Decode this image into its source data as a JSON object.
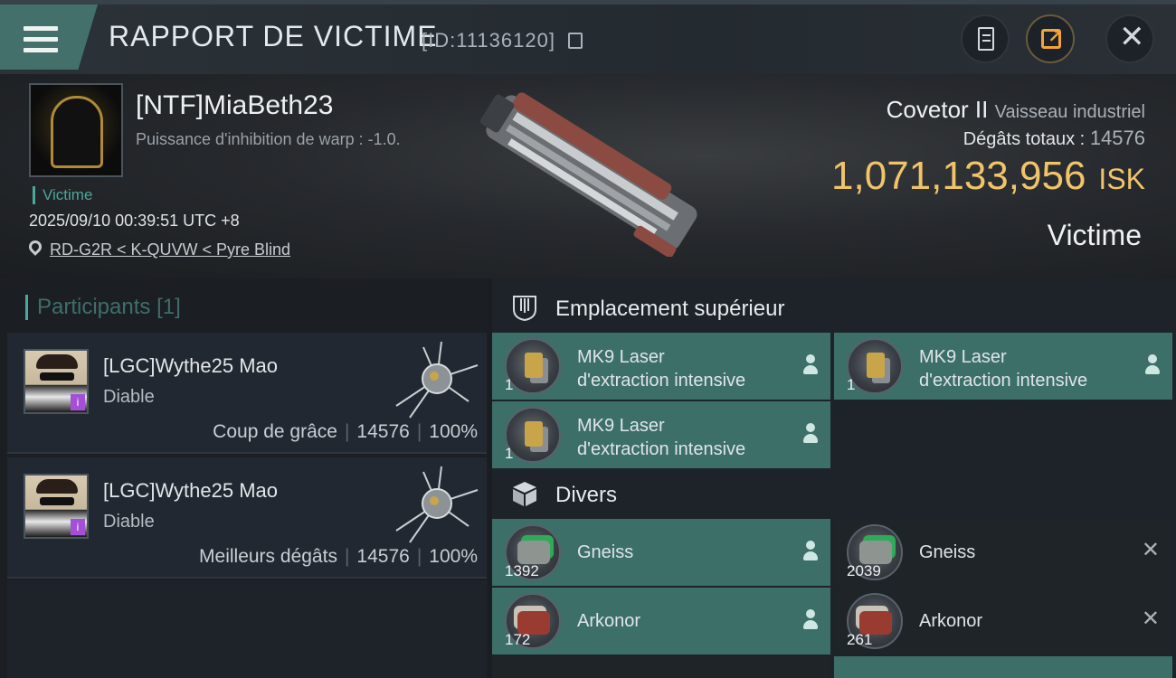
{
  "header": {
    "title": "RAPPORT DE VICTIME",
    "report_id": "[ID:11136120]"
  },
  "victim": {
    "name": "[NTF]MiaBeth23",
    "warp_strength": "Puissance d'inhibition de warp : -1.0.",
    "tag": "Victime",
    "datetime": "2025/09/10 00:39:51 UTC +8",
    "location": "RD-G2R < K-QUVW < Pyre Blind",
    "ship_name": "Covetor II",
    "ship_class": "Vaisseau industriel",
    "total_damage_label": "Dégâts totaux :",
    "total_damage": "14576",
    "isk_amount": "1,071,133,956",
    "isk_unit": "ISK",
    "role_label": "Victime"
  },
  "participants": {
    "label": "Participants",
    "count": "[1]",
    "cards": [
      {
        "name": "[LGC]Wythe25 Mao",
        "ship": "Diable",
        "role": "Coup de grâce",
        "damage": "14576",
        "percent": "100%"
      },
      {
        "name": "[LGC]Wythe25 Mao",
        "ship": "Diable",
        "role": "Meilleurs dégâts",
        "damage": "14576",
        "percent": "100%"
      }
    ]
  },
  "fitting": {
    "high_slot_title": "Emplacement supérieur",
    "misc_title": "Divers",
    "high_slots": [
      {
        "name_line1": "MK9 Laser",
        "name_line2": "d'extraction intensive",
        "qty": "1",
        "status": "dropped"
      },
      {
        "name_line1": "MK9 Laser",
        "name_line2": "d'extraction intensive",
        "qty": "1",
        "status": "dropped"
      },
      {
        "name_line1": "MK9 Laser",
        "name_line2": "d'extraction intensive",
        "qty": "1",
        "status": "dropped"
      }
    ],
    "misc": [
      {
        "name": "Gneiss",
        "qty": "1392",
        "status": "dropped"
      },
      {
        "name": "Gneiss",
        "qty": "2039",
        "status": "destroyed"
      },
      {
        "name": "Arkonor",
        "qty": "172",
        "status": "dropped"
      },
      {
        "name": "Arkonor",
        "qty": "261",
        "status": "destroyed"
      }
    ]
  },
  "colors": {
    "accent_teal": "#3d6f69",
    "isk_gold": "#f1c46a",
    "victim_green": "#4aa79c"
  },
  "icons": [
    "menu-icon",
    "copy-icon",
    "notes-icon",
    "share-icon",
    "close-icon",
    "location-pin-icon",
    "high-slot-icon",
    "cargo-box-icon",
    "person-icon",
    "x-icon"
  ]
}
